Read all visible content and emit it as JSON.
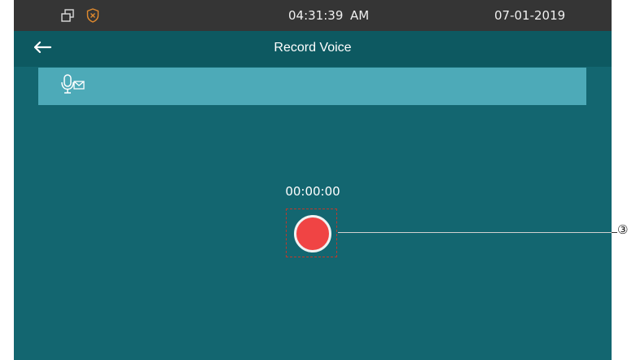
{
  "status_bar": {
    "time": "04:31:39",
    "ampm": "AM",
    "date": "07-01-2019",
    "icons": [
      "window-restore-icon",
      "shield-x-icon"
    ]
  },
  "title_bar": {
    "back_icon": "back-arrow-icon",
    "title": "Record Voice"
  },
  "tab_bar": {
    "active_icon": "voice-message-icon"
  },
  "recorder": {
    "timer": "00:00:00",
    "record_icon": "record-icon"
  },
  "annotation": {
    "callout": "③"
  },
  "colors": {
    "screen_bg": "#136670",
    "status_bar_bg": "#353535",
    "title_bar_bg": "#0d5961",
    "tab_bar_bg": "#4daab8",
    "record_red": "#f04444",
    "highlight_border": "#c0392b"
  }
}
